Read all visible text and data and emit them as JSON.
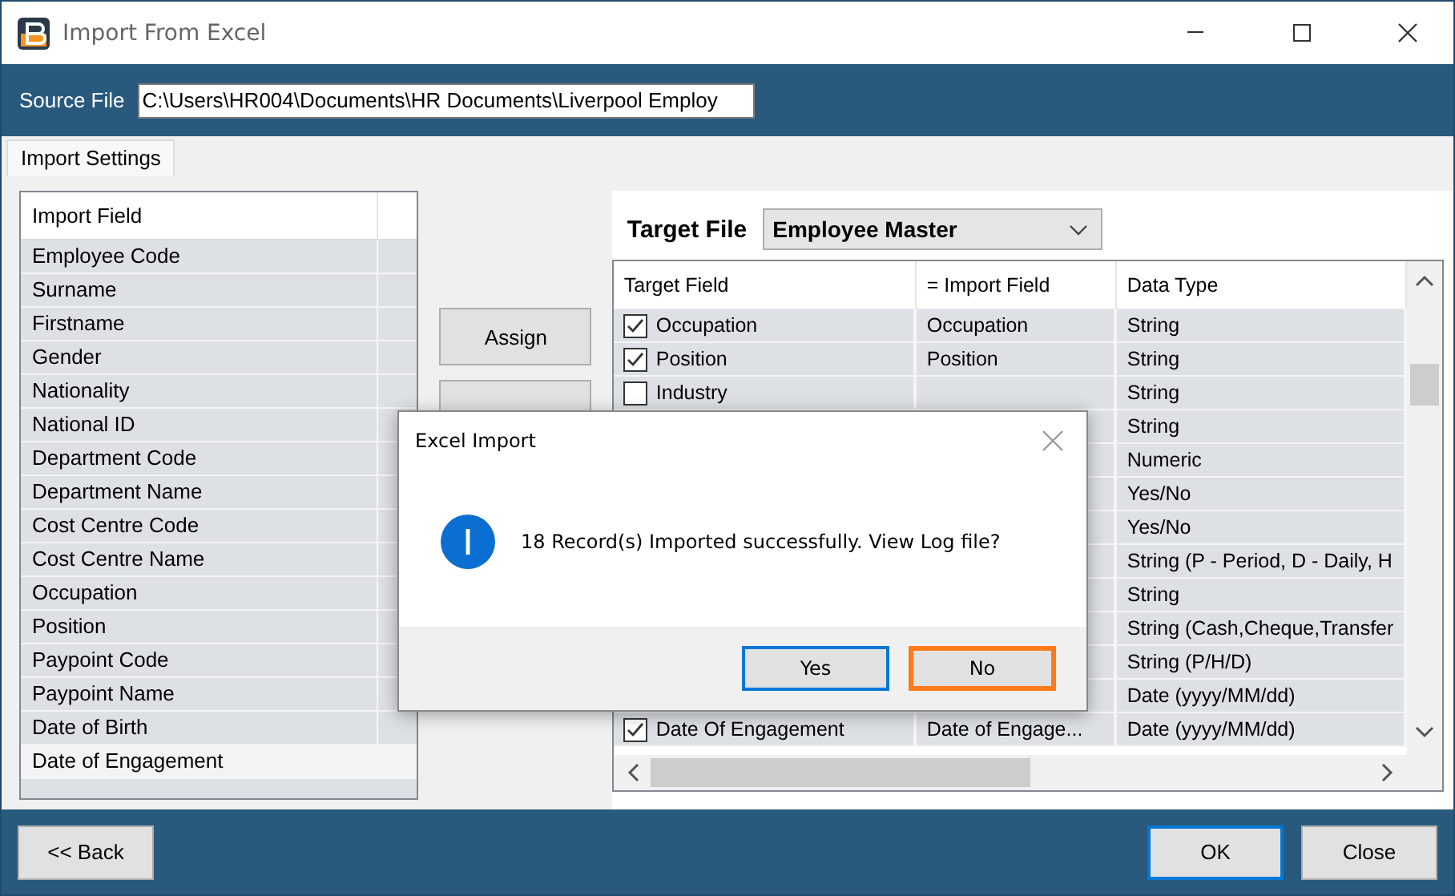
{
  "window": {
    "title": "Import From Excel"
  },
  "source_file": {
    "label": "Source File",
    "value": "C:\\Users\\HR004\\Documents\\HR Documents\\Liverpool Employ"
  },
  "tabs": [
    {
      "label": "Import Settings",
      "selected": true
    }
  ],
  "import_list": {
    "header": "Import Field",
    "items": [
      {
        "label": "Employee Code",
        "selected": false
      },
      {
        "label": "Surname",
        "selected": false
      },
      {
        "label": "Firstname",
        "selected": false
      },
      {
        "label": "Gender",
        "selected": false
      },
      {
        "label": "Nationality",
        "selected": false
      },
      {
        "label": "National ID",
        "selected": false
      },
      {
        "label": "Department Code",
        "selected": false
      },
      {
        "label": "Department Name",
        "selected": false
      },
      {
        "label": "Cost Centre Code",
        "selected": false
      },
      {
        "label": "Cost Centre Name",
        "selected": false
      },
      {
        "label": "Occupation",
        "selected": false
      },
      {
        "label": "Position",
        "selected": false
      },
      {
        "label": "Paypoint Code",
        "selected": false
      },
      {
        "label": "Paypoint Name",
        "selected": false
      },
      {
        "label": "Date of Birth",
        "selected": false
      },
      {
        "label": "Date of Engagement",
        "selected": true
      }
    ]
  },
  "middle_buttons": [
    "Assign"
  ],
  "target_file": {
    "label": "Target File",
    "value": "Employee Master"
  },
  "grid": {
    "columns": [
      "Target Field",
      "= Import Field",
      "Data Type"
    ],
    "rows": [
      {
        "target_field": "Occupation",
        "checked": true,
        "import_field": "Occupation",
        "data_type": "String"
      },
      {
        "target_field": "Position",
        "checked": true,
        "import_field": "Position",
        "data_type": "String"
      },
      {
        "target_field": "Industry",
        "checked": false,
        "data_type": "String"
      },
      {
        "data_type": "String"
      },
      {
        "data_type": "Numeric"
      },
      {
        "data_type": "Yes/No"
      },
      {
        "data_type": "Yes/No"
      },
      {
        "data_type": "String (P - Period, D - Daily, H"
      },
      {
        "data_type": "String"
      },
      {
        "data_type": "String (Cash,Cheque,Transfer"
      },
      {
        "data_type": "String (P/H/D)"
      },
      {
        "data_type": "Date (yyyy/MM/dd)"
      },
      {
        "target_field": "Date Of Engagement",
        "checked": true,
        "import_field": "Date of Engage...",
        "data_type": "Date (yyyy/MM/dd)"
      }
    ]
  },
  "dialog": {
    "title": "Excel Import",
    "message": "18 Record(s) Imported successfully. View Log file?",
    "buttons": [
      {
        "label": "Yes",
        "kind": "default"
      },
      {
        "label": "No",
        "kind": "focused"
      }
    ]
  },
  "footer_buttons": [
    {
      "label": "<< Back",
      "kind": "normal"
    },
    {
      "label": "OK",
      "kind": "default"
    },
    {
      "label": "Close",
      "kind": "normal"
    }
  ]
}
